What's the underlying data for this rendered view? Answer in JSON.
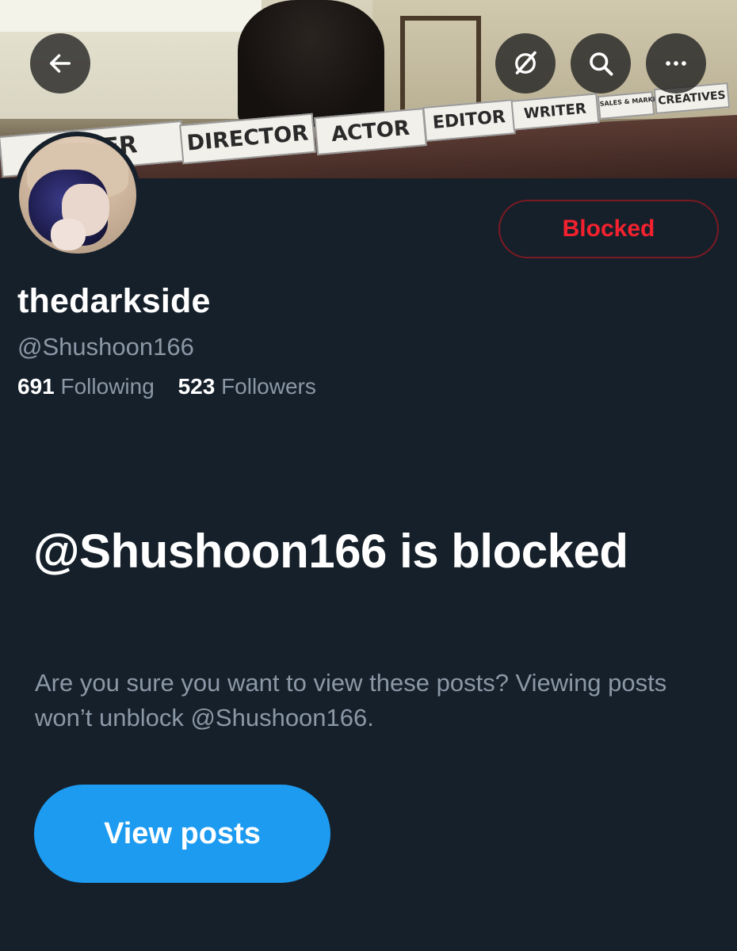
{
  "header": {
    "banner_placards": [
      "DUCER",
      "DIRECTOR",
      "ACTOR",
      "EDITOR",
      "WRITER",
      "SALES & MARKETING",
      "CREATIVES"
    ],
    "back_icon": "arrow-left-icon",
    "grok_icon": "grok-icon",
    "search_icon": "search-icon",
    "more_icon": "ellipsis-icon"
  },
  "profile": {
    "display_name": "thedarkside",
    "handle": "@Shushoon166",
    "following_count": "691",
    "following_label": "Following",
    "followers_count": "523",
    "followers_label": "Followers",
    "blocked_button_label": "Blocked"
  },
  "blocked_notice": {
    "title": "@Shushoon166 is blocked",
    "description": "Are you sure you want to view these posts? Viewing posts won’t unblock @Shushoon166.",
    "view_posts_label": "View posts"
  },
  "colors": {
    "background": "#16202b",
    "blocked_red": "#f4212e",
    "accent_blue": "#1d9bf0",
    "secondary_text": "#8b98a5"
  }
}
